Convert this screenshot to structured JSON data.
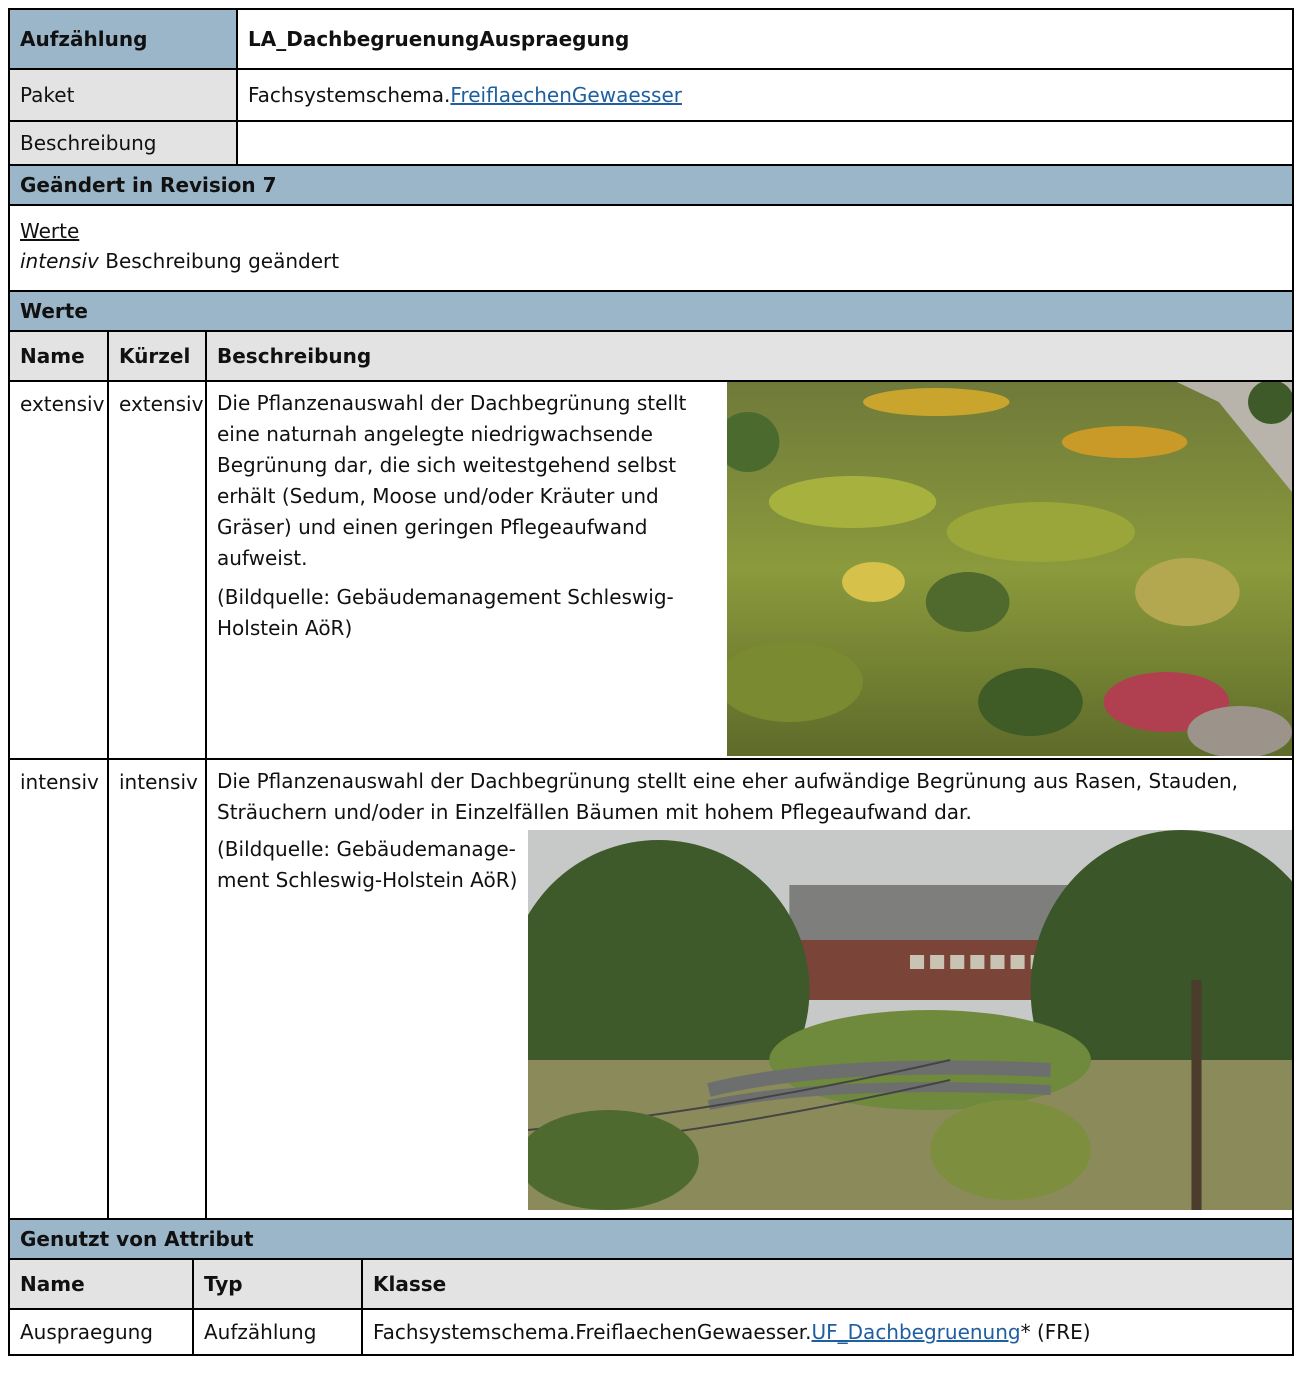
{
  "header": {
    "label": "Aufzählung",
    "name": "LA_DachbegruenungAuspraegung"
  },
  "paket": {
    "label": "Paket",
    "prefix": "Fachsystemschema.",
    "link": "FreiflaechenGewaesser"
  },
  "beschreibung": {
    "label": "Beschreibung",
    "value": ""
  },
  "revision": {
    "title": "Geändert in Revision 7",
    "werte_link": "Werte",
    "change_name": "intensiv",
    "change_text": " Beschreibung geändert"
  },
  "werte": {
    "title": "Werte",
    "columns": [
      "Name",
      "Kürzel",
      "Beschreibung"
    ],
    "rows": [
      {
        "name": "extensiv",
        "kuerzel": "extensiv",
        "text": "Die Pflanzenauswahl der Dachbegrünung stellt eine naturnah angelegte niedrigwachsende Begrünung dar, die sich weitestgehend selbst erhält (Sedum, Moose und/oder Kräuter und Gräser) und einen geringen Pfle­geaufwand aufweist.",
        "source": "(Bildquelle: Gebäudemanagement Schleswig-Holstein AöR)",
        "image": "green-roof-photo"
      },
      {
        "name": "intensiv",
        "kuerzel": "intensiv",
        "text": "Die Pflanzenauswahl der Dachbegrünung stellt eine eher aufwändige Begrünung aus Rasen, Stauden, Sträu­chern und/oder in Einzelfällen Bäumen mit hohem Pflegeaufwand dar.",
        "source": "(Bildquelle: Gebäudemanage­ment Schleswig-Holstein AöR)",
        "image": "roof-garden-photo"
      }
    ]
  },
  "genutzt": {
    "title": "Genutzt von Attribut",
    "columns": [
      "Name",
      "Typ",
      "Klasse"
    ],
    "rows": [
      {
        "name": "Auspraegung",
        "typ": "Aufzählung",
        "klasse_prefix": "Fachsystemschema.FreiflaechenGewaesser.",
        "klasse_link": "UF_Dachbegruenung",
        "klasse_suffix": "* (FRE)"
      }
    ]
  }
}
